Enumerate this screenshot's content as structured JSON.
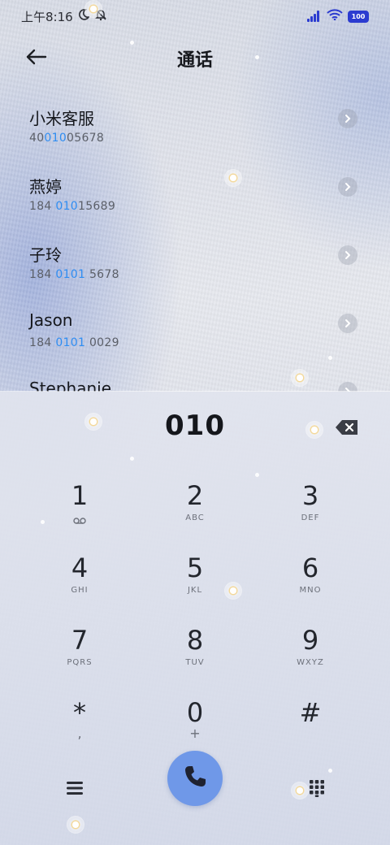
{
  "status_bar": {
    "time": "上午8:16",
    "battery": "100",
    "icons": [
      "moon-icon",
      "mute-bell-icon",
      "signal-icon",
      "wifi-icon",
      "battery-icon"
    ]
  },
  "header": {
    "title": "通话",
    "back_icon": "arrow-left-icon"
  },
  "contacts": [
    {
      "name": "小米客服",
      "num_pre": "40",
      "num_hl": "010",
      "num_post": "05678"
    },
    {
      "name": "燕婷",
      "num_pre": "184 ",
      "num_hl": "010",
      "num_post": "15689"
    },
    {
      "name": "子玲",
      "num_pre": "184 ",
      "num_hl": "0101",
      "num_post": " 5678"
    },
    {
      "name": "Jason",
      "num_pre": "184 ",
      "num_hl": "0101",
      "num_post": " 0029"
    },
    {
      "name": "Stephanie",
      "num_pre": "",
      "num_hl": "",
      "num_post": ""
    }
  ],
  "dialer": {
    "dialed_number": "010",
    "keys": [
      {
        "digit": "1",
        "letters": "",
        "sub": "voicemail-icon"
      },
      {
        "digit": "2",
        "letters": "ABC",
        "sub": ""
      },
      {
        "digit": "3",
        "letters": "DEF",
        "sub": ""
      },
      {
        "digit": "4",
        "letters": "GHI",
        "sub": ""
      },
      {
        "digit": "5",
        "letters": "JKL",
        "sub": ""
      },
      {
        "digit": "6",
        "letters": "MNO",
        "sub": ""
      },
      {
        "digit": "7",
        "letters": "PQRS",
        "sub": ""
      },
      {
        "digit": "8",
        "letters": "TUV",
        "sub": ""
      },
      {
        "digit": "9",
        "letters": "WXYZ",
        "sub": ""
      },
      {
        "digit": "*",
        "letters": ",",
        "sub": ""
      },
      {
        "digit": "0",
        "letters": "+",
        "sub": ""
      },
      {
        "digit": "#",
        "letters": "",
        "sub": ""
      }
    ]
  },
  "bottom_bar": {
    "menu_icon": "menu-icon",
    "call_icon": "phone-icon",
    "keypad_icon": "keypad-icon",
    "call_color": "#6f98e8"
  },
  "colors": {
    "highlight": "#2f8df2",
    "status_accent": "#2b3bd0"
  }
}
